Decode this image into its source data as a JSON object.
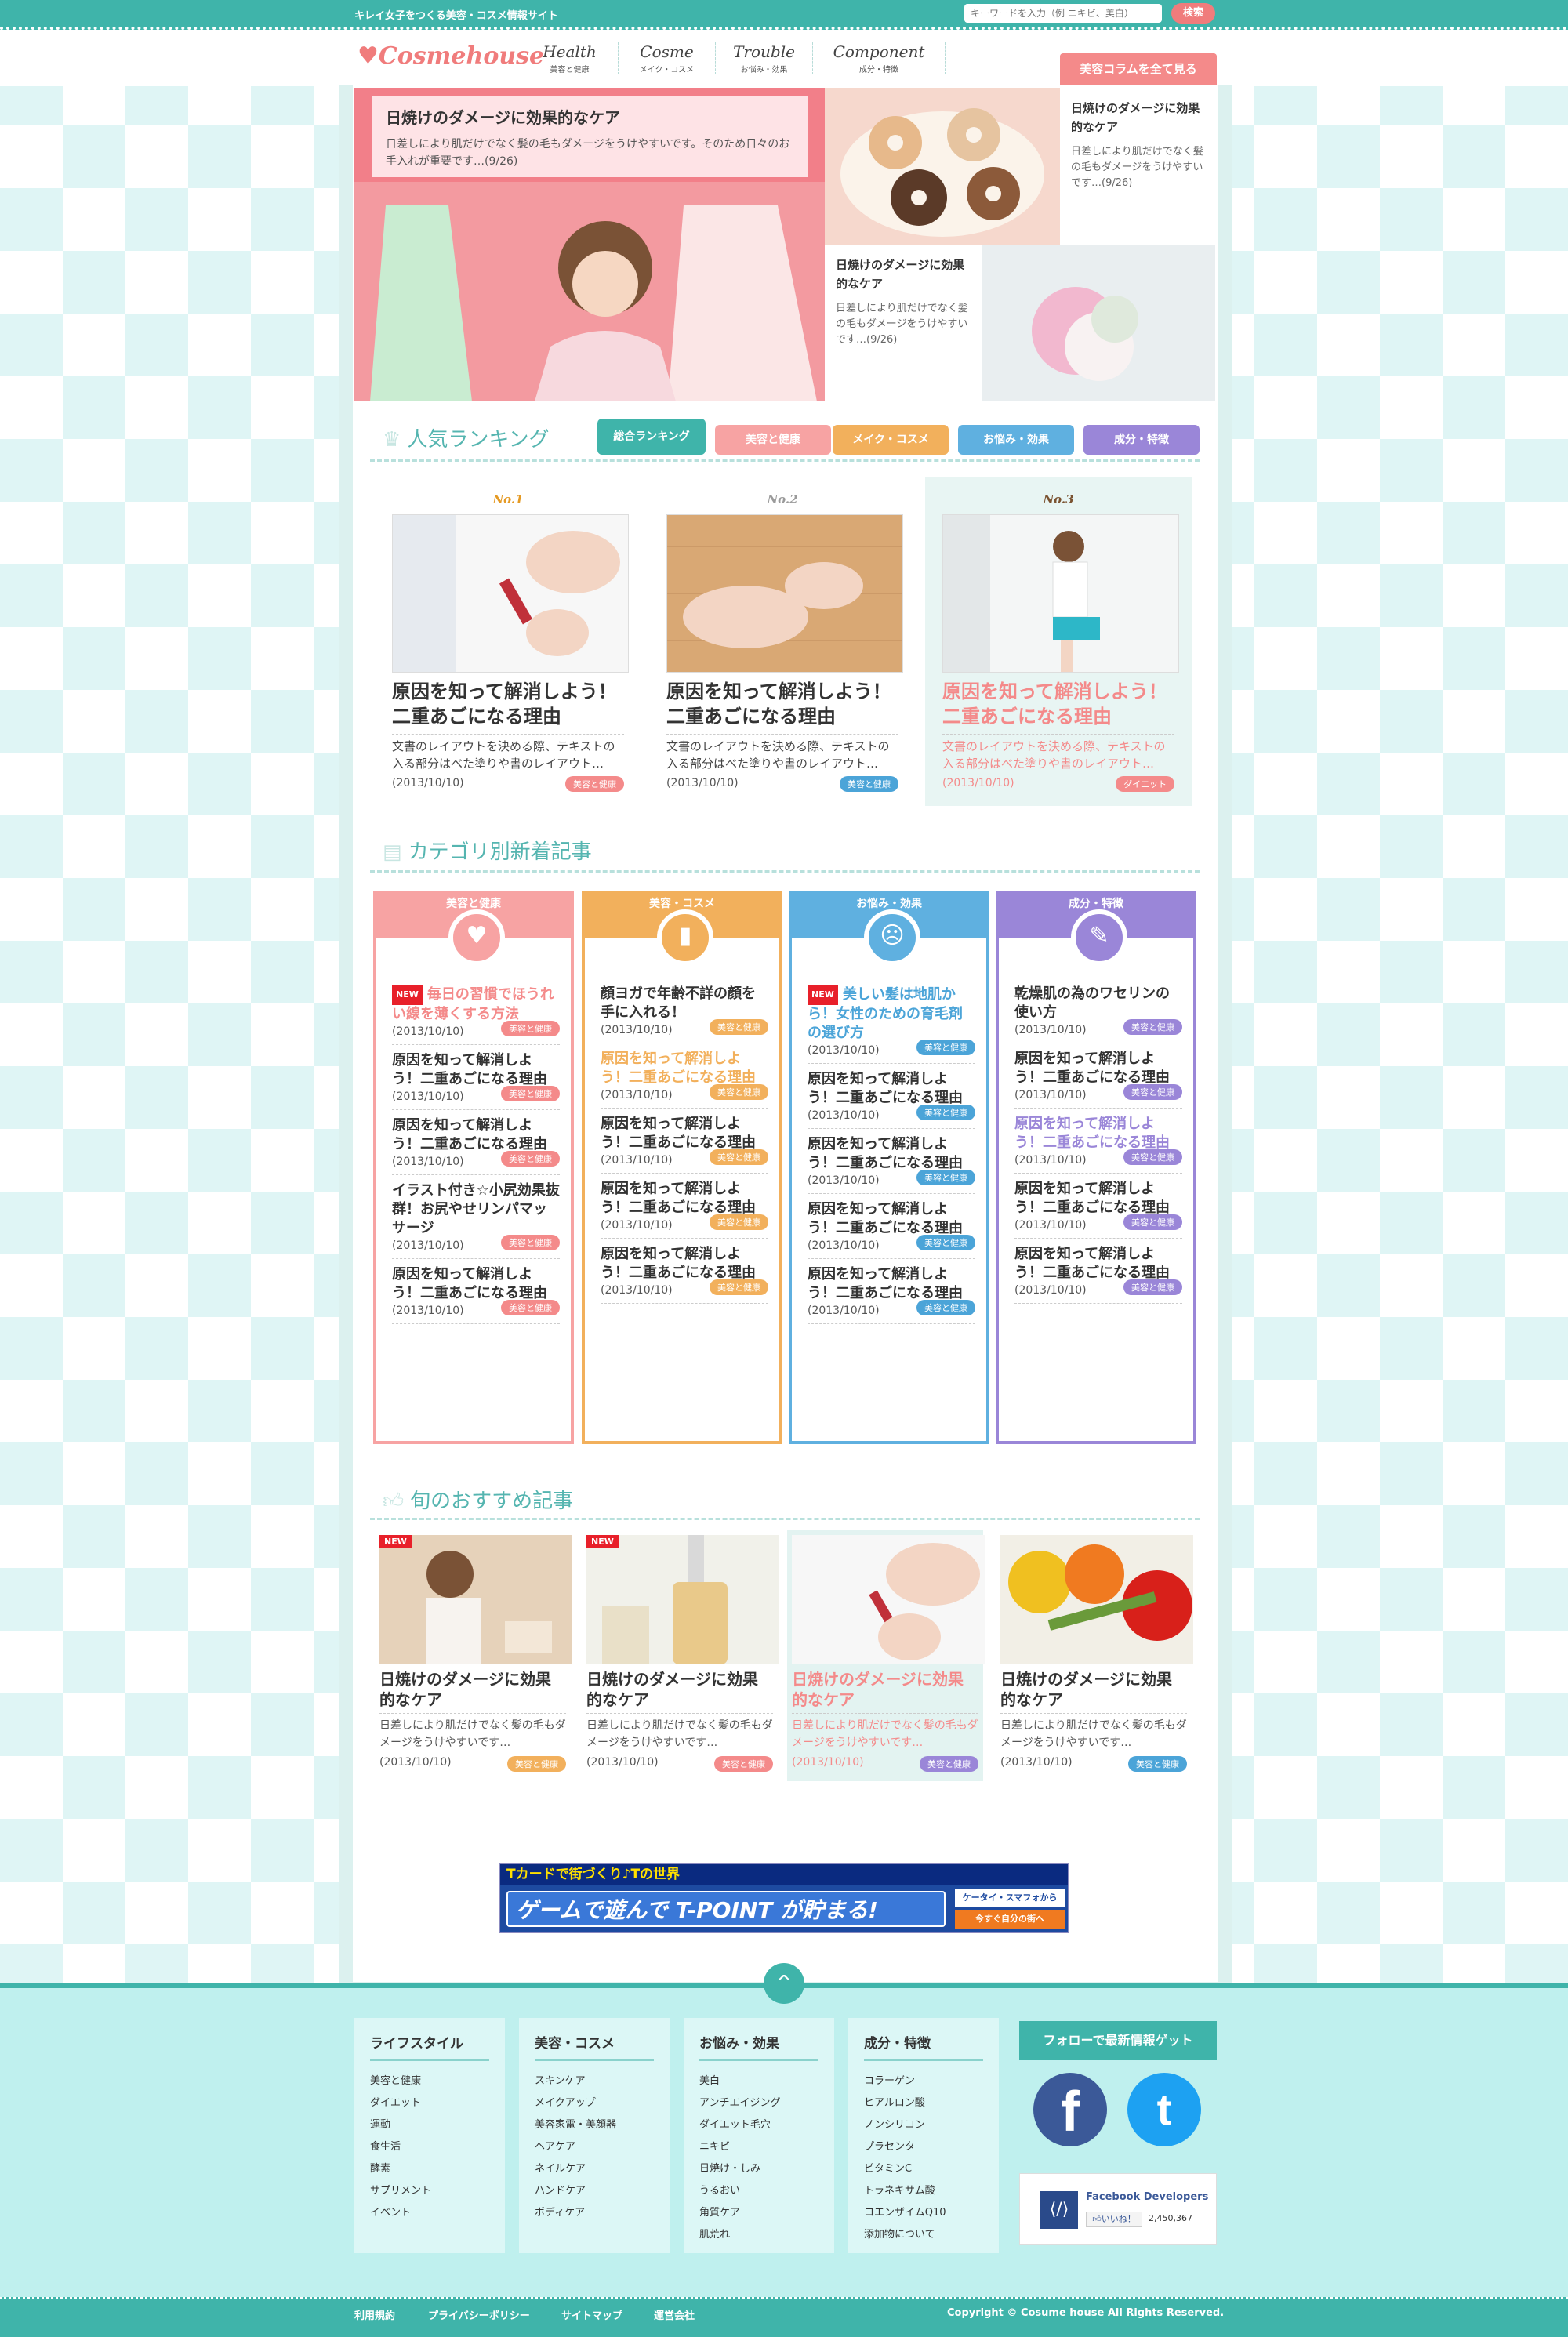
{
  "site": {
    "tagline": "キレイ女子をつくる美容・コスメ情報サイト",
    "logo": "Cosmehouse",
    "search_placeholder": "キーワードを入力（例 ニキビ、美白）",
    "search_button": "検索"
  },
  "nav": [
    {
      "en": "Health",
      "ja": "美容と健康"
    },
    {
      "en": "Cosme",
      "ja": "メイク・コスメ"
    },
    {
      "en": "Trouble",
      "ja": "お悩み・効果"
    },
    {
      "en": "Component",
      "ja": "成分・特徴"
    }
  ],
  "all_columns": "美容コラムを全て見る",
  "hero": {
    "title": "日焼けのダメージに効果的なケア",
    "desc": "日差しにより肌だけでなく髪の毛もダメージをうけやすいです。そのため日々のお手入れが重要です…(9/26)",
    "side": [
      {
        "title": "日焼けのダメージに効果的なケア",
        "desc": "日差しにより肌だけでなく髪の毛もダメージをうけやすいです…(9/26)"
      },
      {
        "title": "日焼けのダメージに効果的なケア",
        "desc": "日差しにより肌だけでなく髪の毛もダメージをうけやすいです…(9/26)"
      }
    ]
  },
  "ranking": {
    "heading": "人気ランキング",
    "tabs": [
      "総合ランキング",
      "美容と健康",
      "メイク・コスメ",
      "お悩み・効果",
      "成分・特徴"
    ],
    "items": [
      {
        "rank": "No.1",
        "title": "原因を知って解消しよう！二重あごになる理由",
        "desc": "文書のレイアウトを決める際、テキストの入る部分はべた塗りや書のレイアウト…",
        "date": "(2013/10/10)",
        "tag": "美容と健康"
      },
      {
        "rank": "No.2",
        "title": "原因を知って解消しよう！二重あごになる理由",
        "desc": "文書のレイアウトを決める際、テキストの入る部分はべた塗りや書のレイアウト…",
        "date": "(2013/10/10)",
        "tag": "美容と健康"
      },
      {
        "rank": "No.3",
        "title": "原因を知って解消しよう！二重あごになる理由",
        "desc": "文書のレイアウトを決める際、テキストの入る部分はべた塗りや書のレイアウト…",
        "date": "(2013/10/10)",
        "tag": "ダイエット"
      }
    ]
  },
  "categories": {
    "heading": "カテゴリ別新着記事",
    "new_label": "NEW",
    "cols": [
      {
        "name": "美容と健康",
        "items": [
          {
            "t": "毎日の習慣でほうれい線を薄くする方法",
            "d": "(2013/10/10)",
            "tag": "美容と健康"
          },
          {
            "t": "原因を知って解消しよう！二重あごになる理由",
            "d": "(2013/10/10)",
            "tag": "美容と健康"
          },
          {
            "t": "原因を知って解消しよう！二重あごになる理由",
            "d": "(2013/10/10)",
            "tag": "美容と健康"
          },
          {
            "t": "イラスト付き☆小尻効果抜群！お尻やせリンパマッサージ",
            "d": "(2013/10/10)",
            "tag": "美容と健康"
          },
          {
            "t": "原因を知って解消しよう！二重あごになる理由",
            "d": "(2013/10/10)",
            "tag": "美容と健康"
          }
        ]
      },
      {
        "name": "美容・コスメ",
        "items": [
          {
            "t": "顔ヨガで年齢不詳の顔を手に入れる！",
            "d": "(2013/10/10)",
            "tag": "美容と健康"
          },
          {
            "t": "原因を知って解消しよう！二重あごになる理由",
            "d": "(2013/10/10)",
            "tag": "美容と健康"
          },
          {
            "t": "原因を知って解消しよう！二重あごになる理由",
            "d": "(2013/10/10)",
            "tag": "美容と健康"
          },
          {
            "t": "原因を知って解消しよう！二重あごになる理由",
            "d": "(2013/10/10)",
            "tag": "美容と健康"
          },
          {
            "t": "原因を知って解消しよう！二重あごになる理由",
            "d": "(2013/10/10)",
            "tag": "美容と健康"
          }
        ]
      },
      {
        "name": "お悩み・効果",
        "items": [
          {
            "t": "美しい髪は地肌から！女性のための育毛剤の選び方",
            "d": "(2013/10/10)",
            "tag": "美容と健康"
          },
          {
            "t": "原因を知って解消しよう！二重あごになる理由",
            "d": "(2013/10/10)",
            "tag": "美容と健康"
          },
          {
            "t": "原因を知って解消しよう！二重あごになる理由",
            "d": "(2013/10/10)",
            "tag": "美容と健康"
          },
          {
            "t": "原因を知って解消しよう！二重あごになる理由",
            "d": "(2013/10/10)",
            "tag": "美容と健康"
          },
          {
            "t": "原因を知って解消しよう！二重あごになる理由",
            "d": "(2013/10/10)",
            "tag": "美容と健康"
          }
        ]
      },
      {
        "name": "成分・特徴",
        "items": [
          {
            "t": "乾燥肌の為のワセリンの使い方",
            "d": "(2013/10/10)",
            "tag": "美容と健康"
          },
          {
            "t": "原因を知って解消しよう！二重あごになる理由",
            "d": "(2013/10/10)",
            "tag": "美容と健康"
          },
          {
            "t": "原因を知って解消しよう！二重あごになる理由",
            "d": "(2013/10/10)",
            "tag": "美容と健康"
          },
          {
            "t": "原因を知って解消しよう！二重あごになる理由",
            "d": "(2013/10/10)",
            "tag": "美容と健康"
          },
          {
            "t": "原因を知って解消しよう！二重あごになる理由",
            "d": "(2013/10/10)",
            "tag": "美容と健康"
          }
        ]
      }
    ]
  },
  "recommend": {
    "heading": "旬のおすすめ記事",
    "new_label": "NEW",
    "items": [
      {
        "title": "日焼けのダメージに効果的なケア",
        "desc": "日差しにより肌だけでなく髪の毛もダメージをうけやすいです…",
        "date": "(2013/10/10)",
        "tag": "美容と健康"
      },
      {
        "title": "日焼けのダメージに効果的なケア",
        "desc": "日差しにより肌だけでなく髪の毛もダメージをうけやすいです…",
        "date": "(2013/10/10)",
        "tag": "美容と健康"
      },
      {
        "title": "日焼けのダメージに効果的なケア",
        "desc": "日差しにより肌だけでなく髪の毛もダメージをうけやすいです…",
        "date": "(2013/10/10)",
        "tag": "美容と健康"
      },
      {
        "title": "日焼けのダメージに効果的なケア",
        "desc": "日差しにより肌だけでなく髪の毛もダメージをうけやすいです…",
        "date": "(2013/10/10)",
        "tag": "美容と健康"
      }
    ]
  },
  "banner": {
    "top": "Tカードで街づくり♪Tの世界",
    "main": "ゲームで遊んで T-POINT が貯まる!",
    "side": "ケータイ・スマフォから",
    "cta": "今すぐ自分の街へ"
  },
  "footer": {
    "cols": [
      {
        "h": "ライフスタイル",
        "items": [
          "美容と健康",
          "ダイエット",
          "運動",
          "食生活",
          "酵素",
          "サプリメント",
          "イベント"
        ]
      },
      {
        "h": "美容・コスメ",
        "items": [
          "スキンケア",
          "メイクアップ",
          "美容家電・美顔器",
          "ヘアケア",
          "ネイルケア",
          "ハンドケア",
          "ボディケア"
        ]
      },
      {
        "h": "お悩み・効果",
        "items": [
          "美白",
          "アンチエイジング",
          "ダイエット毛穴",
          "ニキビ",
          "日焼け・しみ",
          "うるおい",
          "角質ケア",
          "肌荒れ"
        ]
      },
      {
        "h": "成分・特徴",
        "items": [
          "コラーゲン",
          "ヒアルロン酸",
          "ノンシリコン",
          "プラセンタ",
          "ビタミンC",
          "トラネキサム酸",
          "コエンザイムQ10",
          "添加物について"
        ]
      }
    ],
    "follow": "フォローで最新情報ゲット",
    "fb_name": "Facebook Developers",
    "like": "いいね！",
    "like_count": "2,450,367",
    "links": [
      "利用規約",
      "プライバシーポリシー",
      "サイトマップ",
      "運営会社"
    ],
    "copyright": "Copyright © Cosume house All Rights Reserved."
  },
  "colors": {
    "teal": "#3fb4aa",
    "pink": "#f48a8a",
    "orange": "#f2b05c",
    "blue": "#4ba4d8",
    "purple": "#9a86d8"
  }
}
